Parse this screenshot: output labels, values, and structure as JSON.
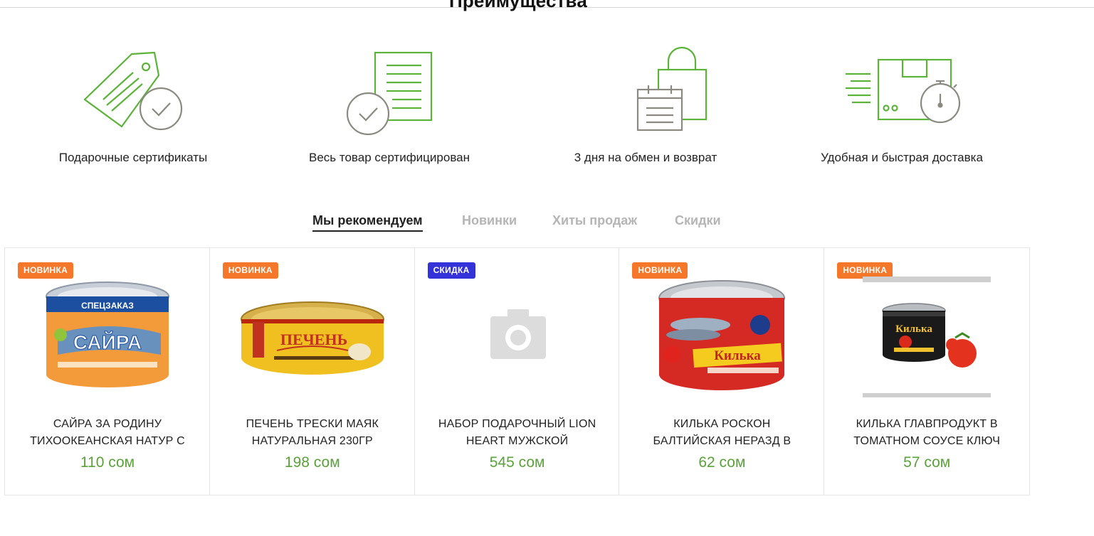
{
  "section": {
    "title": "Преимущества"
  },
  "advantages": [
    {
      "label": "Подарочные сертификаты",
      "icon": "gift-certificate-tag-icon"
    },
    {
      "label": "Весь товар сертифицирован",
      "icon": "certified-document-icon"
    },
    {
      "label": "3 дня на обмен и возврат",
      "icon": "shopping-bag-calendar-icon"
    },
    {
      "label": "Удобная и быстрая доставка",
      "icon": "fast-delivery-box-icon"
    }
  ],
  "tabs": [
    {
      "label": "Мы рекомендуем",
      "active": true
    },
    {
      "label": "Новинки",
      "active": false
    },
    {
      "label": "Хиты продаж",
      "active": false
    },
    {
      "label": "Скидки",
      "active": false
    }
  ],
  "products": [
    {
      "badge": "НОВИНКА",
      "badge_type": "new",
      "name": "Сайра за родину тихоокеанская натур с",
      "price": "110 сом",
      "image": "saury-can-image",
      "can_text": "САЙРА"
    },
    {
      "badge": "НОВИНКА",
      "badge_type": "new",
      "name": "Печень трески Маяк натуральная 230гр",
      "price": "198 сом",
      "image": "cod-liver-can-image",
      "can_text": "ПЕЧЕНЬ"
    },
    {
      "badge": "СКИДКА",
      "badge_type": "sale",
      "name": "Набор подарочный LION HEART мужской",
      "price": "545 сом",
      "image": "no-photo-camera-icon",
      "can_text": ""
    },
    {
      "badge": "НОВИНКА",
      "badge_type": "new",
      "name": "Килька Роскон балтийская неразд в",
      "price": "62 сом",
      "image": "sprat-roskon-can-image",
      "can_text": "Килька"
    },
    {
      "badge": "НОВИНКА",
      "badge_type": "new",
      "name": "Килька Главпродукт в томатном соусе ключ",
      "price": "57 сом",
      "image": "sprat-glavproduct-can-image",
      "can_text": "Килька"
    }
  ],
  "colors": {
    "accent_green": "#5aa23a",
    "icon_green": "#5bb33a",
    "icon_gray": "#8a8a80",
    "badge_new": "#f4772a",
    "badge_sale": "#3432d9"
  }
}
